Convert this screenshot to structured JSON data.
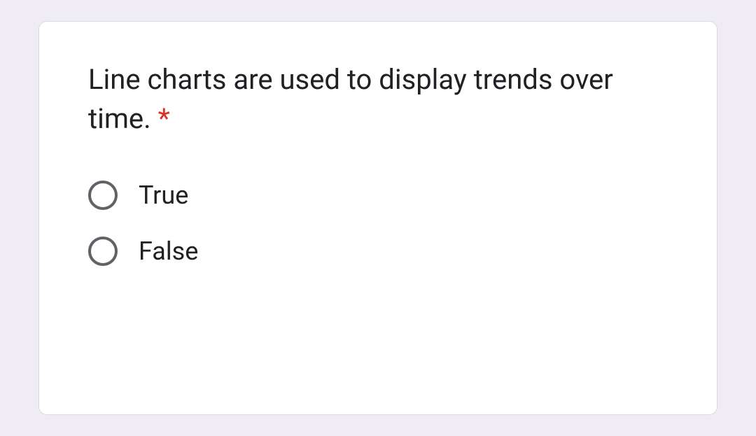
{
  "question": {
    "text": "Line charts are used to display trends over time.",
    "required": true,
    "required_marker": "*"
  },
  "options": [
    {
      "label": "True",
      "selected": false
    },
    {
      "label": "False",
      "selected": false
    }
  ]
}
